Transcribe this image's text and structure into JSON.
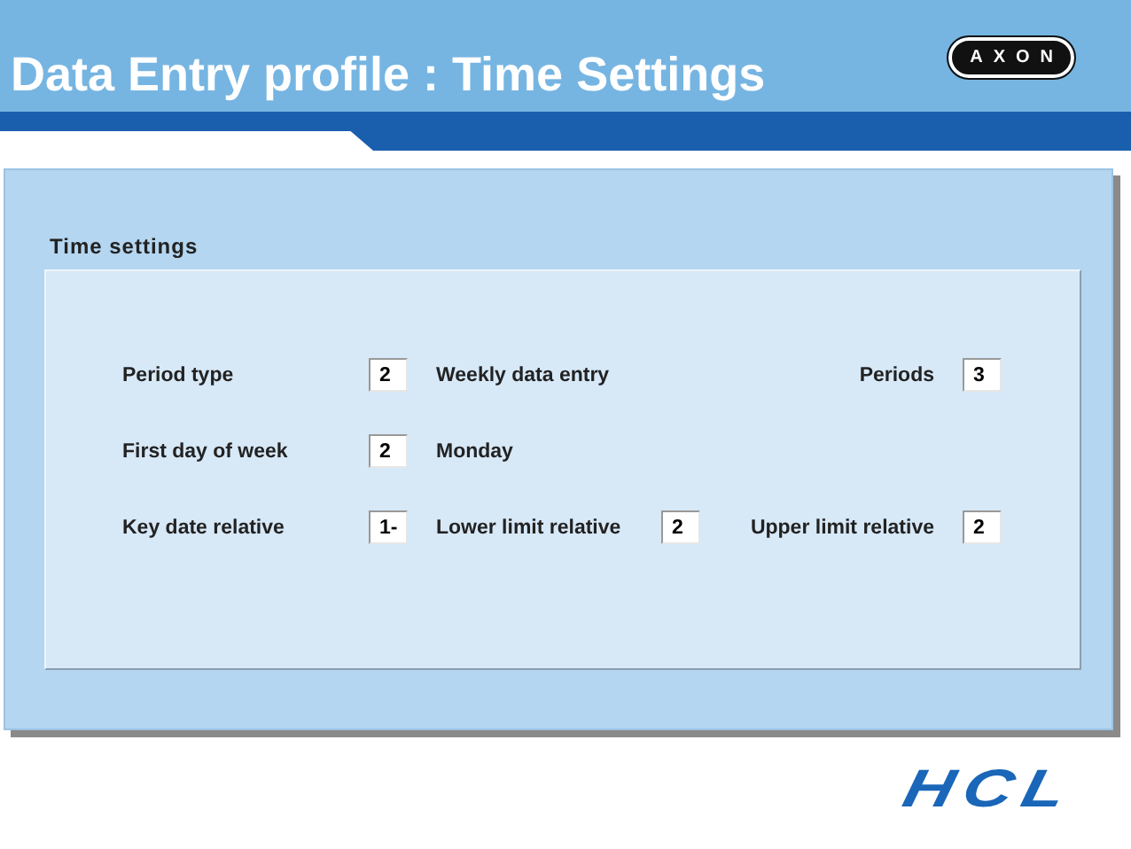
{
  "slide": {
    "title": "Data Entry profile : Time Settings",
    "logo": "AXON",
    "footer_logo": "HCL"
  },
  "screen": {
    "group_title": "Time settings",
    "rows": [
      {
        "items": [
          {
            "kind": "label",
            "text": "Period type"
          },
          {
            "kind": "field",
            "text": "2"
          },
          {
            "kind": "description",
            "text": "Weekly data entry"
          },
          {
            "kind": "right_label",
            "text": "Periods"
          },
          {
            "kind": "field",
            "text": "3"
          }
        ]
      },
      {
        "items": [
          {
            "kind": "label",
            "text": "First day of week"
          },
          {
            "kind": "field",
            "text": "2"
          },
          {
            "kind": "description",
            "text": "Monday"
          }
        ]
      },
      {
        "items": [
          {
            "kind": "label",
            "text": "Key date relative"
          },
          {
            "kind": "field",
            "text": "1-"
          },
          {
            "kind": "label",
            "text": "Lower limit relative"
          },
          {
            "kind": "field",
            "text": "2"
          },
          {
            "kind": "right_label",
            "text": "Upper limit relative"
          },
          {
            "kind": "field",
            "text": "2"
          }
        ]
      }
    ]
  }
}
